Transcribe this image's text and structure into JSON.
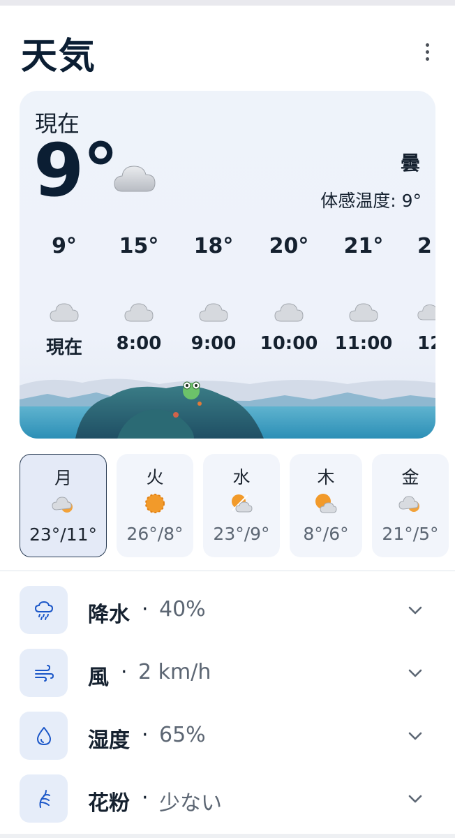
{
  "header": {
    "title": "天気",
    "more_icon": "more-vertical-icon"
  },
  "current": {
    "label": "現在",
    "temperature": "9°",
    "icon": "cloud-icon",
    "condition": "曇",
    "feels_like": "体感温度: 9°"
  },
  "hourly": [
    {
      "temp": "9°",
      "time": "現在",
      "icon": "cloud-icon"
    },
    {
      "temp": "15°",
      "time": "8:00",
      "icon": "cloud-icon"
    },
    {
      "temp": "18°",
      "time": "9:00",
      "icon": "cloud-icon"
    },
    {
      "temp": "20°",
      "time": "10:00",
      "icon": "cloud-icon"
    },
    {
      "temp": "21°",
      "time": "11:00",
      "icon": "cloud-icon"
    },
    {
      "temp": "2",
      "time": "12",
      "icon": "cloud-icon"
    }
  ],
  "daily": [
    {
      "day": "月",
      "temps": "23°/11°",
      "icon": "cloud-sun-icon",
      "selected": true
    },
    {
      "day": "火",
      "temps": "26°/8°",
      "icon": "sun-icon",
      "selected": false
    },
    {
      "day": "水",
      "temps": "23°/9°",
      "icon": "sun-cloud-split-icon",
      "selected": false
    },
    {
      "day": "木",
      "temps": "8°/6°",
      "icon": "sun-behind-cloud-icon",
      "selected": false
    },
    {
      "day": "金",
      "temps": "21°/5°",
      "icon": "cloud-sun-icon",
      "selected": false
    }
  ],
  "details": [
    {
      "label": "降水",
      "value": "40%",
      "icon": "rain-icon"
    },
    {
      "label": "風",
      "value": "2 km/h",
      "icon": "wind-icon"
    },
    {
      "label": "湿度",
      "value": "65%",
      "icon": "droplet-icon"
    },
    {
      "label": "花粉",
      "value": "少ない",
      "icon": "pollen-icon"
    }
  ],
  "colors": {
    "accent": "#1a56c8",
    "card_bg": "#eef3fa",
    "chip_bg": "#e6edf9"
  }
}
